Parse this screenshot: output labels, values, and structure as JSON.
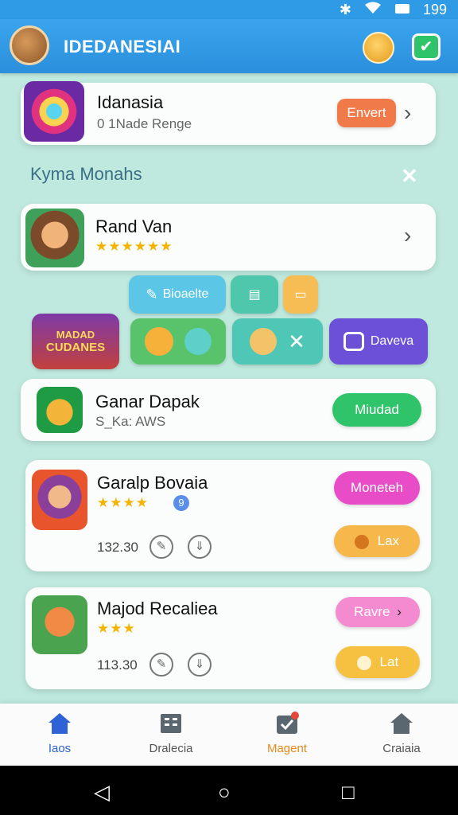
{
  "status_bar": {
    "icons": [
      "bluetooth-icon",
      "wifi-icon",
      "battery-icon"
    ],
    "time": "199"
  },
  "app_bar": {
    "title": "IDEDANESIAI"
  },
  "featured": {
    "name": "Idanasia",
    "subtitle": "0 1Nade Renge",
    "action_label": "Envert"
  },
  "section": {
    "title": "Kyma  Monahs"
  },
  "game1": {
    "name": "Rand Van",
    "stars": "★★★★★★"
  },
  "chips": {
    "blogelle": "Bioaelte",
    "cudanes_line1": "MADAD",
    "cudanes_line2": "CUDANES",
    "daveva": "Daveva"
  },
  "game2": {
    "name": "Ganar Dapak",
    "subtitle": "S_Ka: AWS",
    "button_label": "Miudad"
  },
  "game3": {
    "name": "Garalp Bovaia",
    "stars": "★★★★",
    "badge": "9",
    "count": "132.30",
    "primary_label": "Moneteh",
    "secondary_label": "Lax"
  },
  "game4": {
    "name": "Majod Recaliea",
    "stars": "★★★",
    "count": "113.30",
    "primary_label": "Ravre",
    "secondary_label": "Lat"
  },
  "bottom_nav": [
    {
      "label": "Iaos"
    },
    {
      "label": "Dralecia"
    },
    {
      "label": "Magent"
    },
    {
      "label": "Craiaia"
    }
  ],
  "colors": {
    "primary": "#2f9ae6",
    "background": "#bfe9de",
    "accent_orange": "#f07a4a",
    "accent_green": "#2fc46a",
    "accent_magenta": "#e84dc7",
    "accent_pink": "#f48ad0",
    "accent_amber": "#f6c141",
    "accent_purple": "#6d50d8"
  }
}
